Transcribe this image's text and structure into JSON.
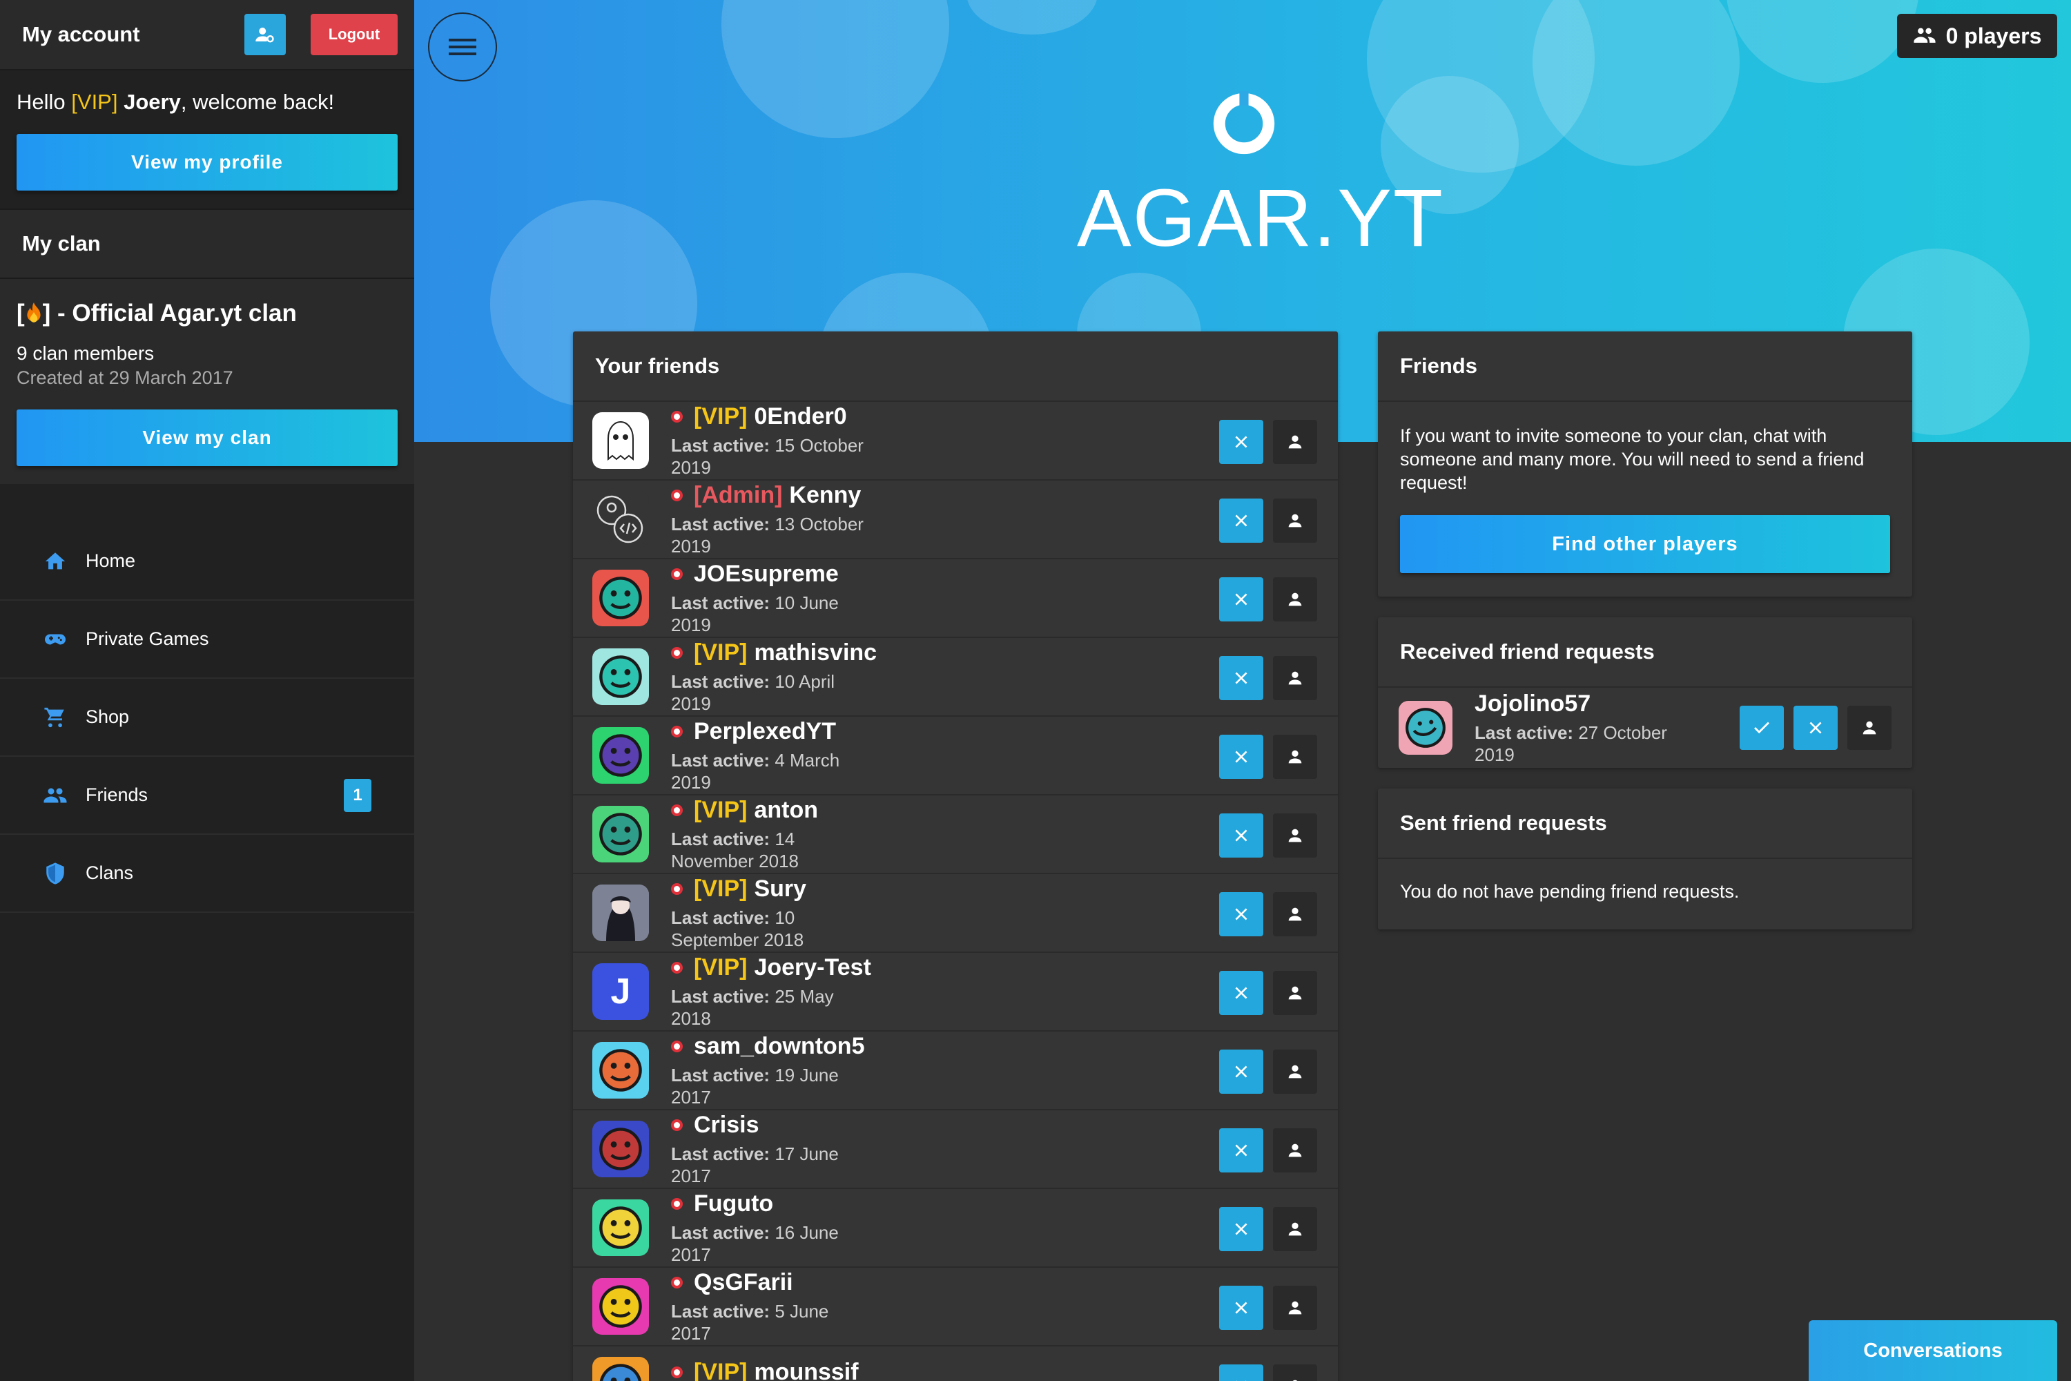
{
  "sidebar": {
    "title": "My account",
    "logout_label": "Logout",
    "hello_prefix": "Hello",
    "hello_rank": "[VIP]",
    "hello_name": "Joery",
    "hello_suffix": ", welcome back!",
    "view_profile_label": "View my profile",
    "clan_header": "My clan",
    "clan_name_prefix": "[",
    "clan_name_suffix": "] - Official Agar.yt clan",
    "clan_members": "9 clan members",
    "clan_created": "Created at 29 March 2017",
    "view_clan_label": "View my clan",
    "nav": [
      {
        "label": "Home",
        "icon": "home-icon"
      },
      {
        "label": "Private Games",
        "icon": "gamepad-icon"
      },
      {
        "label": "Shop",
        "icon": "cart-icon"
      },
      {
        "label": "Friends",
        "icon": "people-icon",
        "badge": "1"
      },
      {
        "label": "Clans",
        "icon": "shield-icon"
      }
    ]
  },
  "header": {
    "players_label": "0 players",
    "brand": "AGAR.YT"
  },
  "friends": {
    "title": "Your friends",
    "last_active_label": "Last active:",
    "items": [
      {
        "rank": "[VIP]",
        "rank_type": "vip",
        "name": "0Ender0",
        "last_active": "15 October 2019"
      },
      {
        "rank": "[Admin]",
        "rank_type": "admin",
        "name": "Kenny",
        "last_active": "13 October 2019"
      },
      {
        "rank": "",
        "rank_type": "",
        "name": "JOEsupreme",
        "last_active": "10 June 2019"
      },
      {
        "rank": "[VIP]",
        "rank_type": "vip",
        "name": "mathisvinc",
        "last_active": "10 April 2019"
      },
      {
        "rank": "",
        "rank_type": "",
        "name": "PerplexedYT",
        "last_active": "4 March 2019"
      },
      {
        "rank": "[VIP]",
        "rank_type": "vip",
        "name": "anton",
        "last_active": "14 November 2018"
      },
      {
        "rank": "[VIP]",
        "rank_type": "vip",
        "name": "Sury",
        "last_active": "10 September 2018"
      },
      {
        "rank": "[VIP]",
        "rank_type": "vip",
        "name": "Joery-Test",
        "last_active": "25 May 2018"
      },
      {
        "rank": "",
        "rank_type": "",
        "name": "sam_downton5",
        "last_active": "19 June 2017"
      },
      {
        "rank": "",
        "rank_type": "",
        "name": "Crisis",
        "last_active": "17 June 2017"
      },
      {
        "rank": "",
        "rank_type": "",
        "name": "Fuguto",
        "last_active": "16 June 2017"
      },
      {
        "rank": "",
        "rank_type": "",
        "name": "QsGFarii",
        "last_active": "5 June 2017"
      },
      {
        "rank": "[VIP]",
        "rank_type": "vip",
        "name": "mounssif",
        "last_active": ""
      }
    ]
  },
  "info": {
    "title": "Friends",
    "text": "If you want to invite someone to your clan, chat with someone and many more. You will need to send a friend request!",
    "find_label": "Find other players"
  },
  "received": {
    "title": "Received friend requests",
    "name": "Jojolino57",
    "last_active_label": "Last active:",
    "last_active": "27 October 2019"
  },
  "sent": {
    "title": "Sent friend requests",
    "empty_text": "You do not have pending friend requests."
  },
  "conversations_label": "Conversations",
  "colors": {
    "accent": "#24a7dc",
    "vip": "#f5c518",
    "admin": "#e8585f",
    "logout": "#e0424b",
    "offline_dot": "#e0303a"
  }
}
